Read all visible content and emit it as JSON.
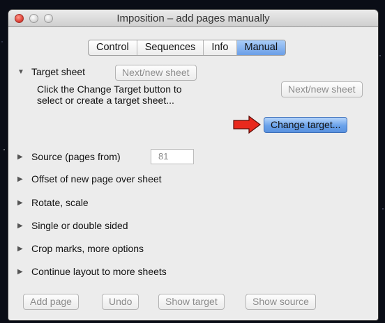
{
  "window": {
    "title": "Imposition – add pages manually"
  },
  "tabs": [
    {
      "label": "Control",
      "active": false
    },
    {
      "label": "Sequences",
      "active": false
    },
    {
      "label": "Info",
      "active": false
    },
    {
      "label": "Manual",
      "active": true
    }
  ],
  "target_sheet": {
    "label": "Target sheet",
    "next_button_top": "Next/new sheet",
    "help_line1": "Click the Change Target button to",
    "help_line2": "select or create a target sheet...",
    "next_button_right": "Next/new sheet",
    "change_target_button": "Change target..."
  },
  "sections": {
    "source": {
      "label": "Source (pages from)",
      "value": "81"
    },
    "offset": "Offset of new page over sheet",
    "rotate": "Rotate, scale",
    "sided": "Single or double sided",
    "crop": "Crop marks, more options",
    "continue": "Continue layout to more sheets"
  },
  "footer": {
    "add_page": "Add page",
    "undo": "Undo",
    "show_target": "Show target",
    "show_source": "Show source"
  },
  "colors": {
    "accent": "#6aa2ea",
    "arrow": "#e8291d",
    "window_bg": "#ececec"
  }
}
